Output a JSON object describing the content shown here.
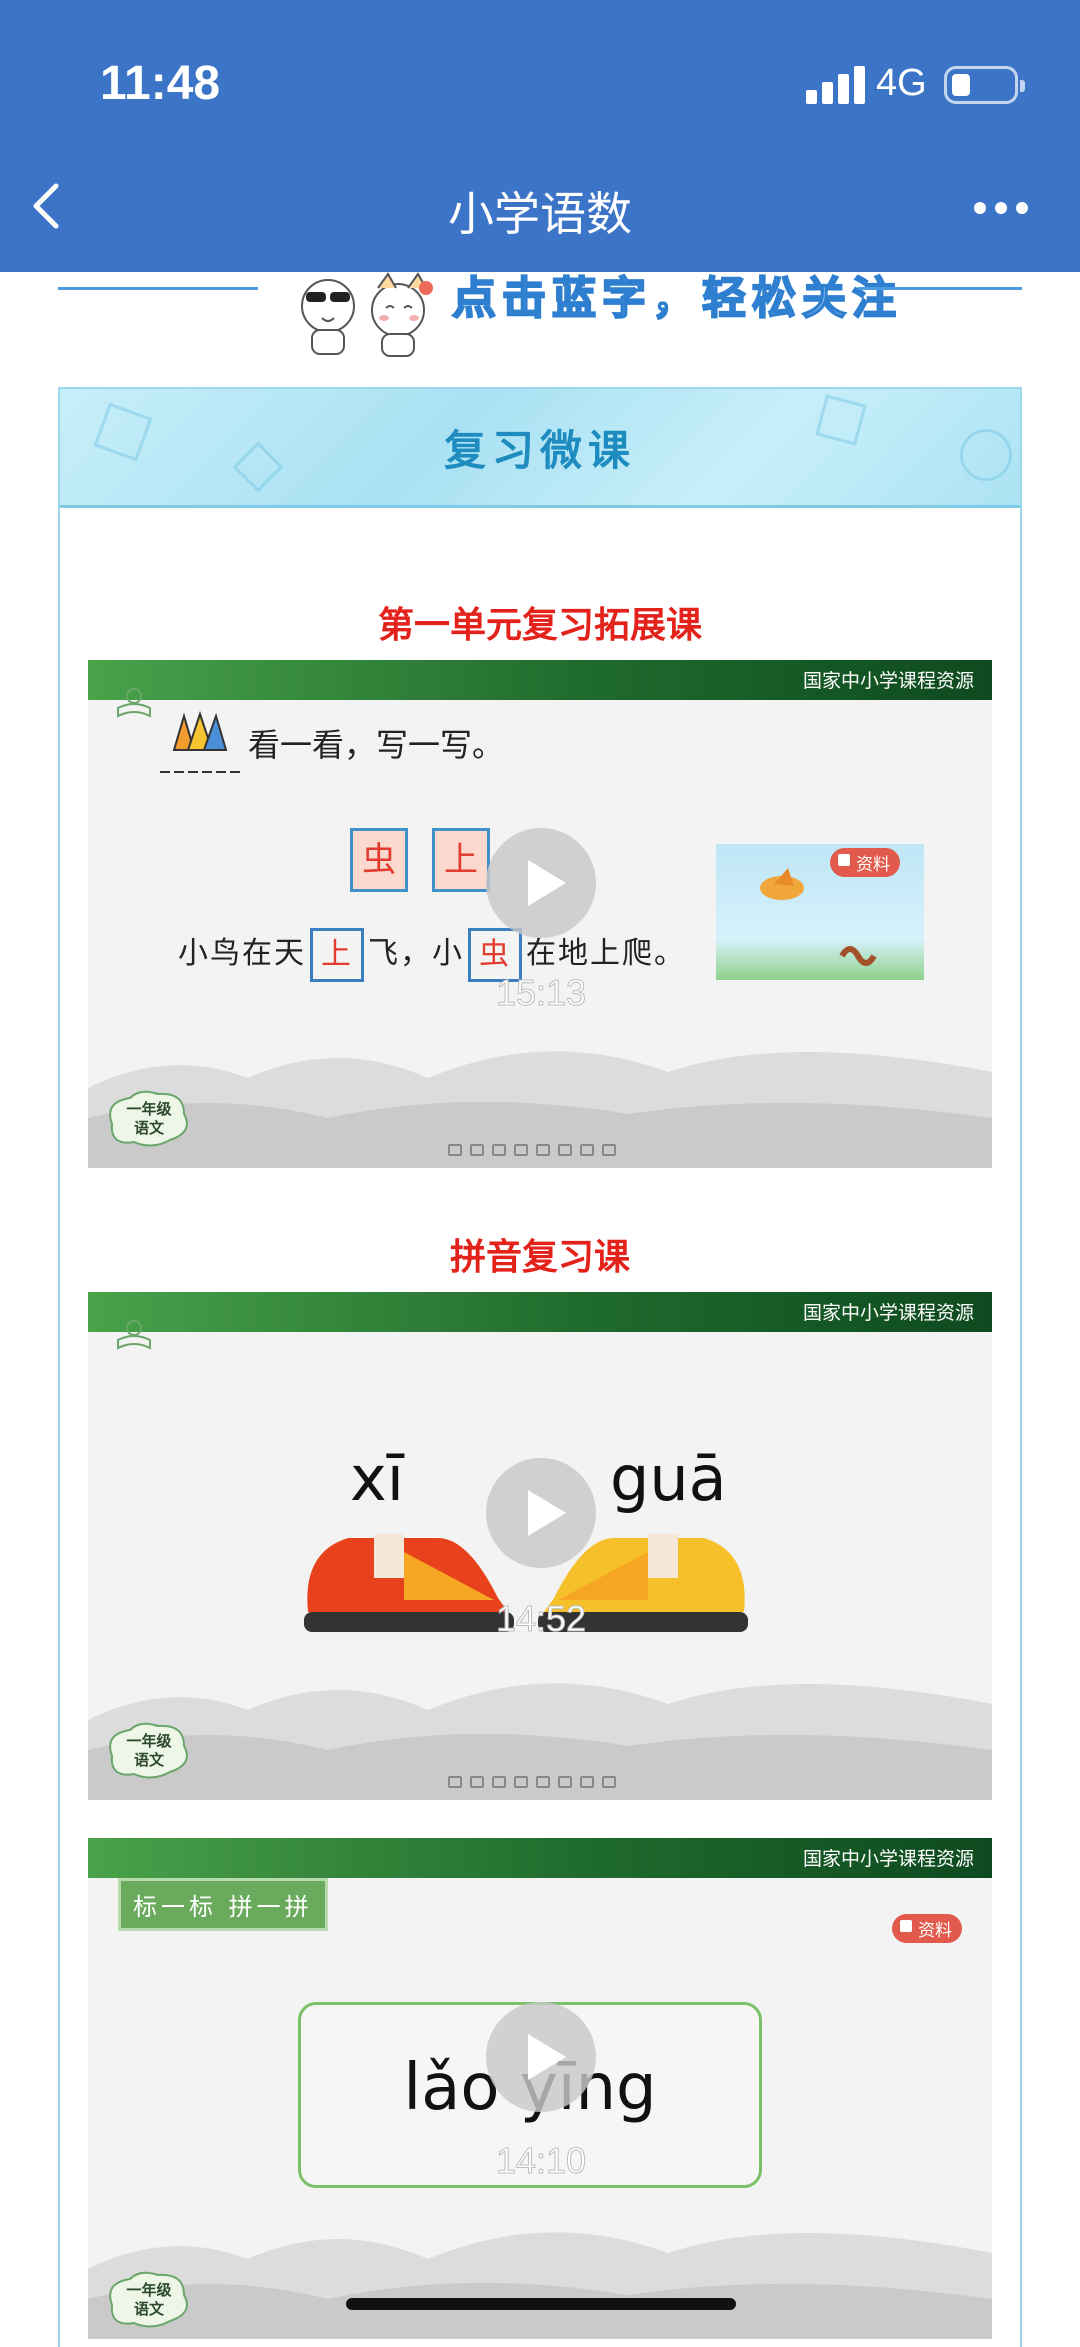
{
  "status_bar": {
    "time": "11:48",
    "network": "4G"
  },
  "nav": {
    "title": "小学语数",
    "back_icon": "chevron-left-icon",
    "more_icon": "more-dots-icon"
  },
  "follow_banner": {
    "text": "点击蓝字，轻松关注"
  },
  "card": {
    "title": "复习微课"
  },
  "videos": [
    {
      "section_title": "第一单元复习拓展课",
      "source": "国家中小学课程资源",
      "duration": "15:13",
      "prompt": "看一看，写一写。",
      "cards": [
        "虫",
        "上"
      ],
      "sentence_a": "小鸟在天",
      "blank_a": "上",
      "sentence_b": "飞，小",
      "blank_b": "虫",
      "sentence_c": "在地上爬。",
      "resource_tag": "资料",
      "grade": [
        "一年级",
        "语文"
      ]
    },
    {
      "section_title": "拼音复习课",
      "source": "国家中小学课程资源",
      "duration": "14:52",
      "pinyin_left": "xī",
      "pinyin_right": "guā",
      "grade": [
        "一年级",
        "语文"
      ]
    },
    {
      "source": "国家中小学课程资源",
      "duration": "14:10",
      "tag": "标一标 拼一拼",
      "resource_tag": "资料",
      "word": "lǎo yīng",
      "grade": [
        "一年级",
        "语文"
      ]
    }
  ],
  "colors": {
    "header": "#3c74c8",
    "section_title": "#e3231b",
    "card_title": "#1f8cbf",
    "video_bar": "#1f6b2d"
  }
}
